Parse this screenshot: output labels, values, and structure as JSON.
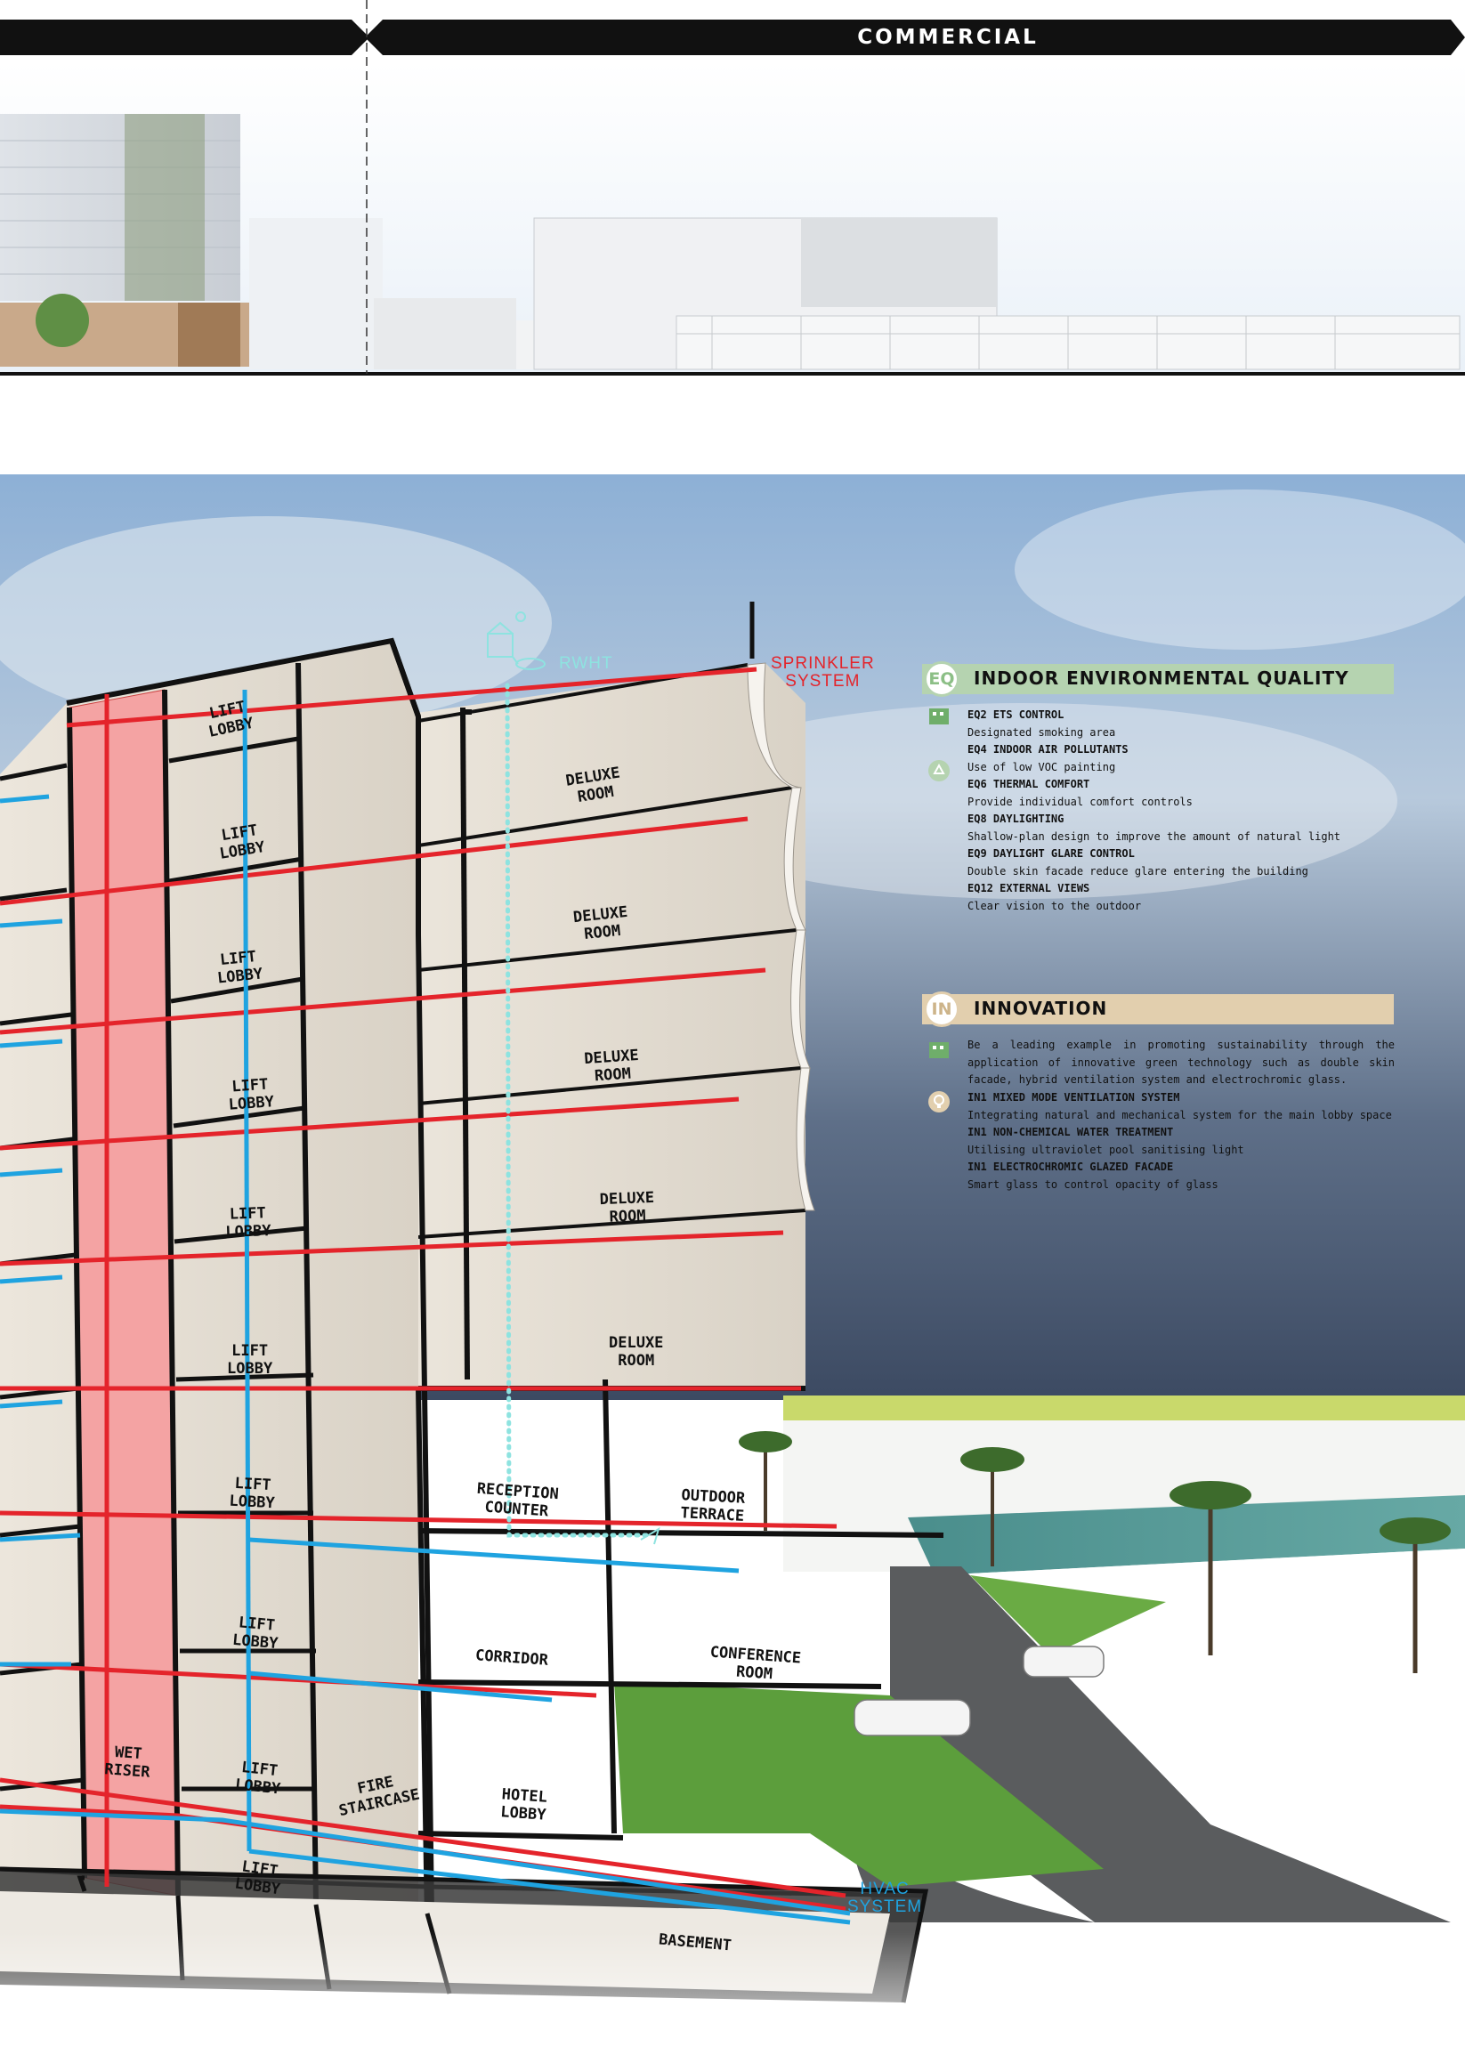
{
  "top_section": {
    "band_label": "COMMERCIAL"
  },
  "labels": {
    "lift_lobby_1": "LIFT\nLOBBY",
    "lift_lobby_2": "LIFT\nLOBBY",
    "lift_lobby_3": "LIFT\nLOBBY",
    "lift_lobby_4": "LIFT\nLOBBY",
    "lift_lobby_5": "LIFT\nLOBBY",
    "lift_lobby_6": "LIFT\nLOBBY",
    "lift_lobby_7": "LIFT\nLOBBY",
    "lift_lobby_8": "LIFT\nLOBBY",
    "lift_lobby_9": "LIFT\nLOBBY",
    "lift_lobby_10": "LIFT\nLOBBY",
    "deluxe_1": "DELUXE\nROOM",
    "deluxe_2": "DELUXE\nROOM",
    "deluxe_3": "DELUXE\nROOM",
    "deluxe_4": "DELUXE\nROOM",
    "deluxe_5": "DELUXE\nROOM",
    "reception": "RECEPTION\nCOUNTER",
    "outdoor_terrace": "OUTDOOR\nTERRACE",
    "corridor": "CORRIDOR",
    "conference": "CONFERENCE\nROOM",
    "wet_riser": "WET\nRISER",
    "fire_staircase": "FIRE\nSTAIRCASE",
    "hotel_lobby": "HOTEL\nLOBBY",
    "basement": "BASEMENT",
    "rwht": "RWHT",
    "sprinkler": "SPRINKLER\nSYSTEM",
    "hvac": "HVAC\nSYSTEM"
  },
  "eq": {
    "badge": "EQ",
    "title": "INDOOR ENVIRONMENTAL QUALITY",
    "color": "#b5d3b0",
    "items": [
      {
        "code": "EQ2 ETS CONTROL",
        "desc": "Designated smoking area"
      },
      {
        "code": "EQ4 INDOOR AIR POLLUTANTS",
        "desc": "Use of low VOC painting"
      },
      {
        "code": "EQ6 THERMAL COMFORT",
        "desc": "Provide individual comfort controls"
      },
      {
        "code": "EQ8 DAYLIGHTING",
        "desc": "Shallow-plan design to improve the amount of natural light"
      },
      {
        "code": "EQ9 DAYLIGHT GLARE CONTROL",
        "desc": "Double skin facade reduce glare entering the building"
      },
      {
        "code": "EQ12 EXTERNAL VIEWS",
        "desc": "Clear vision to the outdoor"
      }
    ]
  },
  "in": {
    "badge": "IN",
    "title": "INNOVATION",
    "color": "#e2cfae",
    "intro": "Be a leading example in promoting sustainability through the application of innovative green technology such as double skin facade, hybrid ventilation system and electrochromic glass.",
    "items": [
      {
        "code": "IN1 MIXED MODE VENTILATION SYSTEM",
        "desc": "Integrating natural and mechanical system for the main lobby space"
      },
      {
        "code": "IN1 NON-CHEMICAL WATER TREATMENT",
        "desc": "Utilising ultraviolet pool sanitising light"
      },
      {
        "code": "IN1 ELECTROCHROMIC GLAZED FACADE",
        "desc": "Smart glass to control opacity of glass"
      }
    ]
  },
  "colors": {
    "sprinkler": "#e4242b",
    "hvac": "#1fa3e0",
    "rwht": "#8ee3e0",
    "wet_riser": "#f4a3a3"
  }
}
